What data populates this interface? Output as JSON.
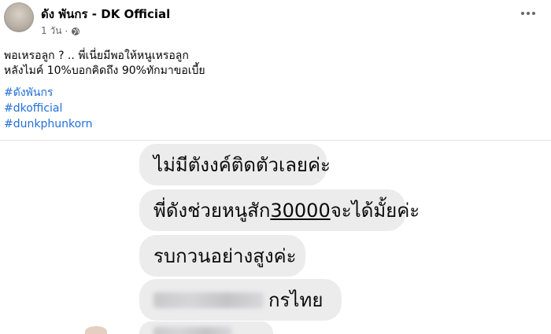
{
  "post": {
    "author_name": "ดัง พันกร - DK Official",
    "timestamp": "1 วัน",
    "separator": "·",
    "privacy_icon": "globe-icon",
    "more_icon": "more-options-icon",
    "caption_lines": [
      "พอเหรอลูก ? .. พี่เนี่ยมีพอให้หนูเหรอลูก",
      "หลังไมค์ 10%บอกคิดถึง  90%ทักมาขอเบี้ย"
    ],
    "hashtags": [
      "#ดังพันกร",
      "#dkofficial",
      "#dunkphunkorn"
    ]
  },
  "chat_image": {
    "bubbles": {
      "b1": "ไม่มีตังงค์ติดตัวเลยค่ะ",
      "b2_before": "พี่ดังช่วยหนูสัก",
      "b2_amount": "30000",
      "b2_after": "จะได้มั้ยค่ะ",
      "b3": "รบกวนอย่างสูงค่ะ",
      "b4_visible": "กรไทย"
    }
  },
  "colors": {
    "hashtag": "#216fdb",
    "bubble_bg": "#ececed",
    "meta_text": "#65676b",
    "divider": "#e4e6eb"
  }
}
